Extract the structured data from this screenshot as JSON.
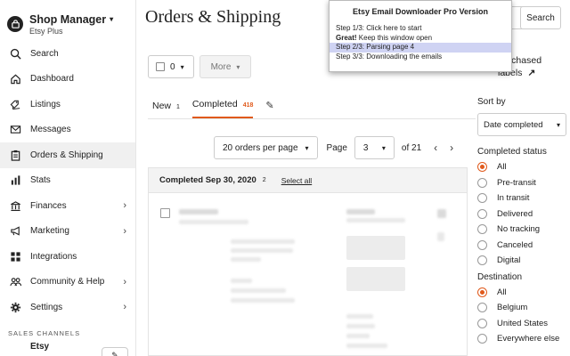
{
  "brand": {
    "title": "Shop Manager",
    "subtitle": "Etsy Plus"
  },
  "nav": [
    {
      "label": "Search",
      "icon": "search-icon",
      "chevron": false
    },
    {
      "label": "Dashboard",
      "icon": "home-icon",
      "chevron": false
    },
    {
      "label": "Listings",
      "icon": "tags-icon",
      "chevron": false
    },
    {
      "label": "Messages",
      "icon": "envelope-icon",
      "chevron": false
    },
    {
      "label": "Orders & Shipping",
      "icon": "clipboard-icon",
      "chevron": false,
      "active": true
    },
    {
      "label": "Stats",
      "icon": "bar-chart-icon",
      "chevron": false
    },
    {
      "label": "Finances",
      "icon": "bank-icon",
      "chevron": true
    },
    {
      "label": "Marketing",
      "icon": "megaphone-icon",
      "chevron": true
    },
    {
      "label": "Integrations",
      "icon": "grid-icon",
      "chevron": false
    },
    {
      "label": "Community & Help",
      "icon": "people-icon",
      "chevron": true
    },
    {
      "label": "Settings",
      "icon": "gear-icon",
      "chevron": true
    }
  ],
  "sales_channels": {
    "heading": "SALES CHANNELS",
    "etsy": "Etsy"
  },
  "main": {
    "title": "Orders & Shipping",
    "search_button": "Search",
    "select_count": "0",
    "more_label": "More",
    "purchased_labels": [
      "purchased",
      "labels"
    ],
    "tabs": [
      {
        "label": "New",
        "count": "1"
      },
      {
        "label": "Completed",
        "count": "418",
        "active": true
      }
    ],
    "per_page": "20 orders per page",
    "page_label": "Page",
    "page_value": "3",
    "page_of": "of 21",
    "group": {
      "title": "Completed Sep 30, 2020",
      "count": "2",
      "select_all": "Select all"
    }
  },
  "filters": {
    "sort_heading": "Sort by",
    "sort_value": "Date completed",
    "status_heading": "Completed status",
    "status_options": [
      "All",
      "Pre-transit",
      "In transit",
      "Delivered",
      "No tracking",
      "Canceled",
      "Digital"
    ],
    "status_selected": 0,
    "dest_heading": "Destination",
    "dest_options": [
      "All",
      "Belgium",
      "United States",
      "Everywhere else"
    ],
    "dest_selected": 0
  },
  "popup": {
    "title": "Etsy Email Downloader Pro Version",
    "step1": "Step 1/3: Click here to start",
    "step_great_bold": "Great!",
    "step_great_rest": " Keep this window open",
    "step2": "Step 2/3: Parsing page 4",
    "step3": "Step 3/3: Downloading the emails"
  },
  "colors": {
    "accent": "#e05a1c",
    "highlight": "#cfd3f3"
  }
}
